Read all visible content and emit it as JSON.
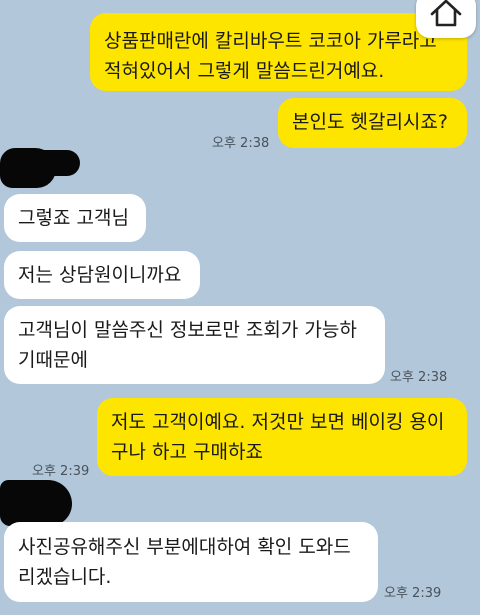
{
  "messages": [
    {
      "sender": "me",
      "lines": [
        "상품판매란에 칼리바우트 코코아 가루라고",
        "적혀있어서 그렇게 말씀드린거예요."
      ]
    },
    {
      "sender": "me",
      "lines": [
        "본인도 헷갈리시죠?"
      ],
      "time": "오후 2:38"
    },
    {
      "sender": "them",
      "lines": [
        "그렇죠 고객님"
      ]
    },
    {
      "sender": "them",
      "lines": [
        "저는 상담원이니까요"
      ]
    },
    {
      "sender": "them",
      "lines": [
        "고객님이 말씀주신 정보로만 조회가 가능하",
        "기때문에"
      ],
      "time": "오후 2:38"
    },
    {
      "sender": "me",
      "lines": [
        "저도 고객이예요. 저것만 보면 베이킹 용이",
        "구나 하고 구매하죠"
      ],
      "time": "오후 2:39"
    },
    {
      "sender": "them",
      "lines": [
        "사진공유해주신 부분에대하여 확인 도와드",
        "리겠습니다."
      ],
      "time": "오후 2:39"
    }
  ],
  "icons": {
    "home": "home-icon"
  },
  "colors": {
    "background": "#b2c7d9",
    "my_bubble": "#fee500",
    "their_bubble": "#ffffff"
  }
}
